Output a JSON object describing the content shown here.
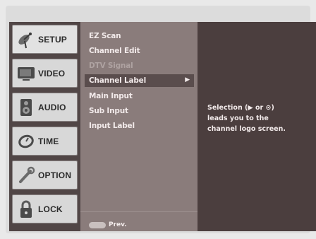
{
  "sidebar": {
    "tabs": [
      {
        "label": "SETUP",
        "icon": "satellite-dish-icon",
        "active": true
      },
      {
        "label": "VIDEO",
        "icon": "tv-icon",
        "active": false
      },
      {
        "label": "AUDIO",
        "icon": "speaker-icon",
        "active": false
      },
      {
        "label": "TIME",
        "icon": "clock-icon",
        "active": false
      },
      {
        "label": "OPTION",
        "icon": "wrench-icon",
        "active": false
      },
      {
        "label": "LOCK",
        "icon": "padlock-icon",
        "active": false
      }
    ]
  },
  "menu": {
    "items": [
      {
        "label": "EZ Scan",
        "state": "normal"
      },
      {
        "label": "Channel Edit",
        "state": "normal"
      },
      {
        "label": "DTV Signal",
        "state": "disabled"
      },
      {
        "label": "Channel Label",
        "state": "selected"
      },
      {
        "label": "Main Input",
        "state": "normal"
      },
      {
        "label": "Sub Input",
        "state": "normal"
      },
      {
        "label": "Input Label",
        "state": "normal"
      }
    ],
    "selected_arrow": "▶",
    "footer": {
      "label": "Prev."
    }
  },
  "description": {
    "lines": [
      "Selection (▶ or ⊙)",
      "leads you to the",
      "channel logo screen."
    ]
  },
  "colors": {
    "screen_bg": "#4b3e3e",
    "menu_bg": "#8a7c7b",
    "selected_bg": "#5a4d4d",
    "tab_bg": "#d8d8d8"
  }
}
